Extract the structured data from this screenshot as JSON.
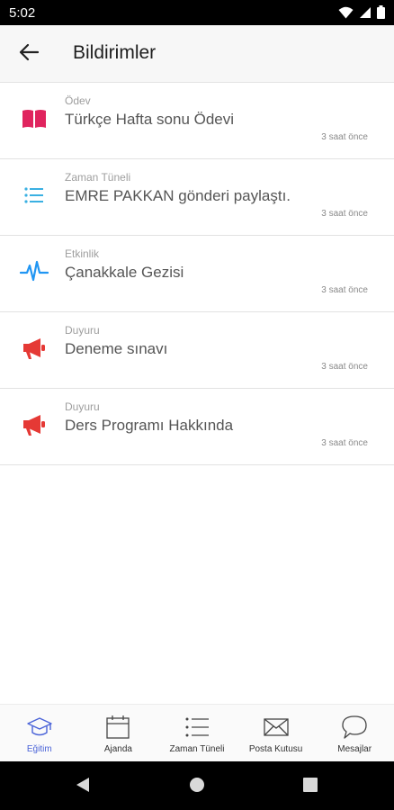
{
  "status_bar": {
    "time": "5:02",
    "icons": [
      "wifi-icon",
      "cellular-signal-icon",
      "battery-icon"
    ]
  },
  "app_bar": {
    "title": "Bildirimler",
    "back_icon": "arrow-left-icon"
  },
  "notifications": [
    {
      "category": "Ödev",
      "text": "Türkçe Hafta sonu Ödevi",
      "time": "3 saat önce",
      "icon": "book-icon",
      "icon_color": "#e0245e"
    },
    {
      "category": "Zaman Tüneli",
      "text": "EMRE PAKKAN gönderi paylaştı.",
      "time": "3 saat önce",
      "icon": "list-icon",
      "icon_color": "#3ab0e2"
    },
    {
      "category": "Etkinlik",
      "text": "Çanakkale Gezisi",
      "time": "3 saat önce",
      "icon": "pulse-icon",
      "icon_color": "#2196f3"
    },
    {
      "category": "Duyuru",
      "text": "Deneme sınavı",
      "time": "3 saat önce",
      "icon": "megaphone-icon",
      "icon_color": "#e53935"
    },
    {
      "category": "Duyuru",
      "text": "Ders Programı Hakkında",
      "time": "3 saat önce",
      "icon": "megaphone-icon",
      "icon_color": "#e53935"
    }
  ],
  "bottom_nav": [
    {
      "label": "Eğitim",
      "icon": "graduation-cap-icon",
      "active": true
    },
    {
      "label": "Ajanda",
      "icon": "calendar-icon",
      "active": false
    },
    {
      "label": "Zaman Tüneli",
      "icon": "list-icon",
      "active": false
    },
    {
      "label": "Posta Kutusu",
      "icon": "envelope-icon",
      "active": false
    },
    {
      "label": "Mesajlar",
      "icon": "chat-bubble-icon",
      "active": false
    }
  ],
  "system_nav": [
    "back-triangle-icon",
    "home-circle-icon",
    "recents-square-icon"
  ],
  "colors": {
    "accent": "#4a63d8",
    "status_bar": "#000000",
    "app_bar": "#f7f7f7"
  }
}
